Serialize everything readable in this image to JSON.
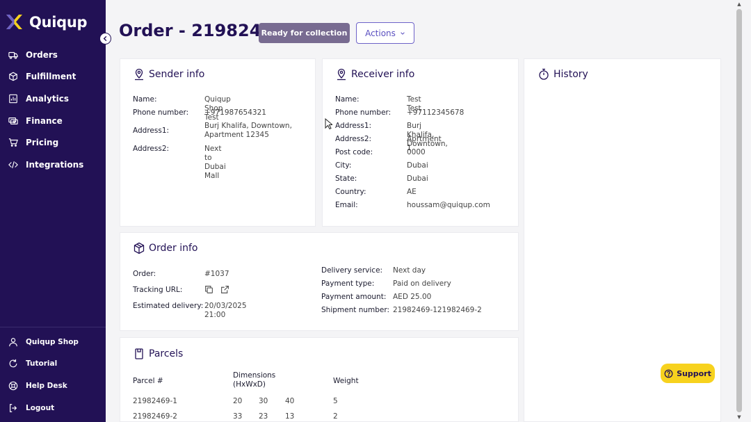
{
  "brand": {
    "name": "Quiqup"
  },
  "nav": {
    "items": [
      {
        "label": "Orders",
        "icon": "truck-icon"
      },
      {
        "label": "Fulfillment",
        "icon": "box-icon"
      },
      {
        "label": "Analytics",
        "icon": "chart-icon"
      },
      {
        "label": "Finance",
        "icon": "cash-icon"
      },
      {
        "label": "Pricing",
        "icon": "cart-icon"
      },
      {
        "label": "Integrations",
        "icon": "code-icon"
      }
    ],
    "bottom": [
      {
        "label": "Quiqup Shop",
        "icon": "user-icon"
      },
      {
        "label": "Tutorial",
        "icon": "refresh-icon"
      },
      {
        "label": "Help Desk",
        "icon": "lifebuoy-icon"
      },
      {
        "label": "Logout",
        "icon": "logout-icon"
      }
    ]
  },
  "header": {
    "title": "Order - 21982469",
    "status": "Ready for collection",
    "actions_label": "Actions"
  },
  "sender": {
    "title": "Sender info",
    "name_label": "Name:",
    "name": "Quiqup Shop Test",
    "phone_label": "Phone number:",
    "phone": "+971987654321",
    "address1_label": "Address1:",
    "address1_line1": "Burj Khalifa, Downtown,",
    "address1_line2": "Apartment 12345",
    "address2_label": "Address2:",
    "address2": "Next to Dubai Mall"
  },
  "receiver": {
    "title": "Receiver info",
    "name_label": "Name:",
    "name": "Test Test",
    "phone_label": "Phone number:",
    "phone": "+97112345678",
    "address1_label": "Address1:",
    "address1": "Burj Khalifa, Downtown,",
    "address2_label": "Address2:",
    "address2": "Aprtment 1",
    "postcode_label": "Post code:",
    "postcode": "0000",
    "city_label": "City:",
    "city": "Dubai",
    "state_label": "State:",
    "state": "Dubai",
    "country_label": "Country:",
    "country": "AE",
    "email_label": "Email:",
    "email": "houssam@quiqup.com"
  },
  "history": {
    "title": "History"
  },
  "order_info": {
    "title": "Order info",
    "order_label": "Order:",
    "order": "#1037",
    "tracking_label": "Tracking URL:",
    "estimated_label": "Estimated delivery:",
    "estimated": "20/03/2025 21:00",
    "service_label": "Delivery service:",
    "service": "Next day",
    "payment_type_label": "Payment type:",
    "payment_type": "Paid on delivery",
    "payment_amount_label": "Payment amount:",
    "payment_amount": "AED 25.00",
    "shipment_label": "Shipment number:",
    "shipment": "21982469-121982469-2"
  },
  "parcels": {
    "title": "Parcels",
    "col_parcel": "Parcel #",
    "col_dimensions_line1": "Dimensions",
    "col_dimensions_line2": "(HxWxD)",
    "col_weight": "Weight",
    "rows": [
      {
        "id": "21982469-1",
        "h": "20",
        "w": "30",
        "d": "40",
        "weight": "5"
      },
      {
        "id": "21982469-2",
        "h": "33",
        "w": "23",
        "d": "13",
        "weight": "2"
      }
    ]
  },
  "support": {
    "label": "Support"
  },
  "colors": {
    "sidebar": "#221155",
    "status_badge": "#786b91",
    "accent": "#6d62c8",
    "support": "#f7d21e"
  }
}
